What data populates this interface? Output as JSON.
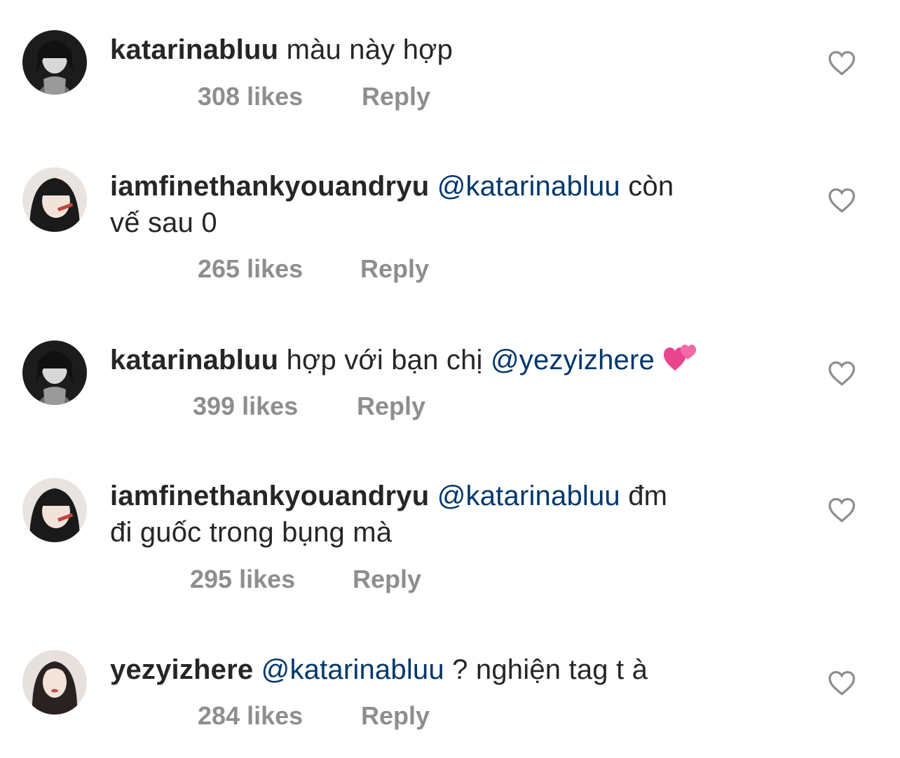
{
  "comments": [
    {
      "username": "katarinabluu",
      "mention": "",
      "text_before": "",
      "text_after": "màu này hợp",
      "likes": "308 likes",
      "reply": "Reply",
      "avatar": "avatar-katarina"
    },
    {
      "username": "iamfinethankyouandryu",
      "mention": "@katarinabluu",
      "text_before": "",
      "text_line1_after": "còn",
      "text_line2": "vế sau 0",
      "likes": "265 likes",
      "reply": "Reply",
      "avatar": "avatar-iamfine"
    },
    {
      "username": "katarinabluu",
      "text_before": "hợp với bạn chị",
      "mention": "@yezyizhere",
      "emoji": "two-hearts-icon",
      "likes": "399 likes",
      "reply": "Reply",
      "avatar": "avatar-katarina"
    },
    {
      "username": "iamfinethankyouandryu",
      "mention": "@katarinabluu",
      "text_line1_after": "đm",
      "text_line2": "đi guốc trong bụng mà",
      "likes": "295 likes",
      "reply": "Reply",
      "avatar": "avatar-iamfine"
    },
    {
      "username": "yezyizhere",
      "mention": "@katarinabluu",
      "text_after": "? nghiện tag t à",
      "likes": "284 likes",
      "reply": "Reply",
      "avatar": "avatar-yezy"
    }
  ],
  "colors": {
    "text": "#262626",
    "mention": "#00376b",
    "meta": "#8e8e8e",
    "heart_outline": "#8e8e8e"
  },
  "icons": [
    "heart-outline-icon",
    "two-hearts-icon"
  ]
}
